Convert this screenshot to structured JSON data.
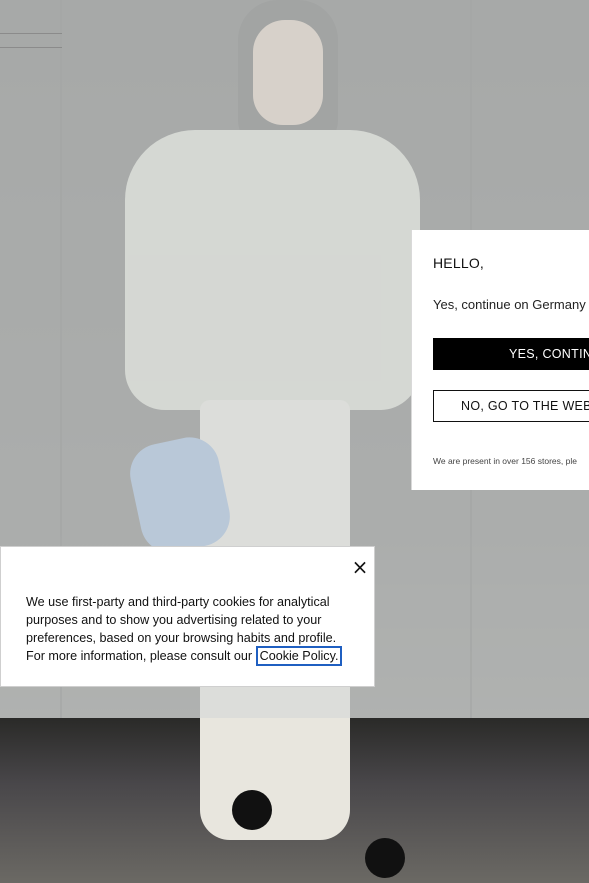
{
  "country_modal": {
    "greeting": "HELLO,",
    "continue_text": "Yes, continue on Germany",
    "yes_label": "YES, CONTIN",
    "no_label": "NO, GO TO THE WEB",
    "stores_text": "We are present in over 156 stores, ple"
  },
  "cookie_banner": {
    "close_icon": "close-icon",
    "body_text": "We use first-party and third-party cookies for analytical purposes and to show you advertising related to your preferences, based on your browsing habits and profile. For more information, please consult our ",
    "policy_link": "Cookie Policy."
  }
}
